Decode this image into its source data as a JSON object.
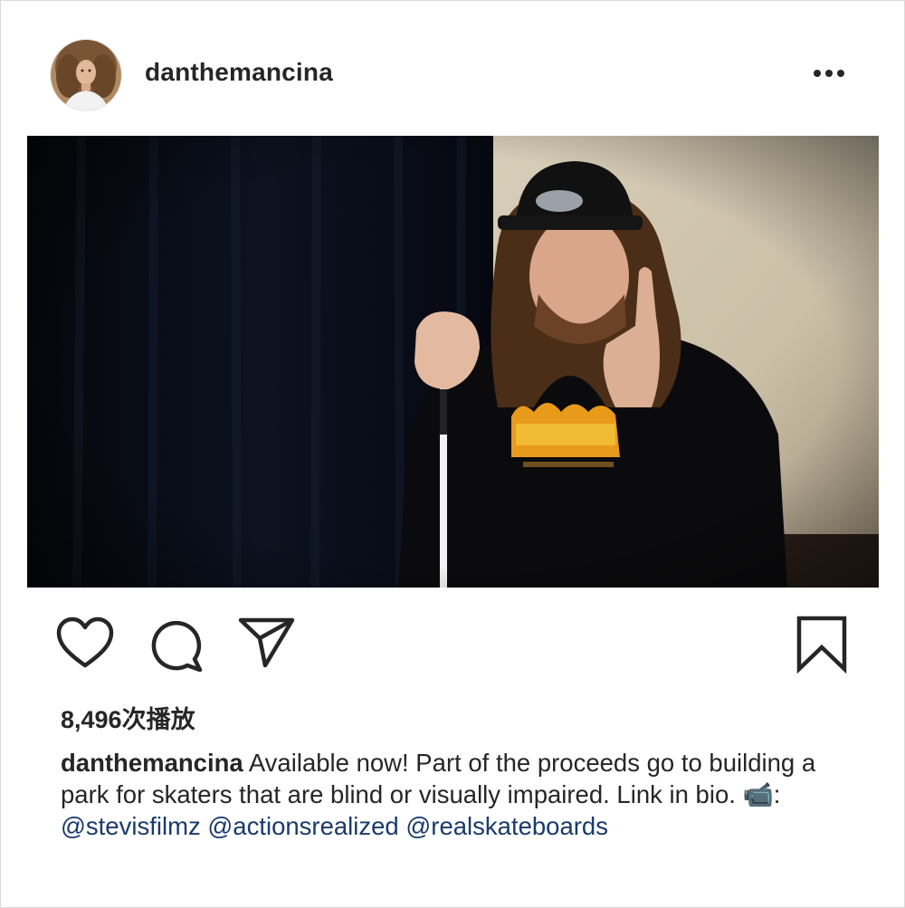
{
  "post": {
    "username": "danthemancina",
    "more_icon": "more-horizontal-icon",
    "media_type": "video"
  },
  "actions": {
    "like_icon": "heart-icon",
    "comment_icon": "comment-bubble-icon",
    "share_icon": "paper-plane-icon",
    "save_icon": "bookmark-icon"
  },
  "stats": {
    "views_text": "8,496次播放"
  },
  "caption": {
    "username": "danthemancina",
    "text_line": " Available now! Part of the proceeds go to building a park for skaters that are blind or visually impaired. Link in bio. ",
    "emoji": "📹",
    "colon": ": ",
    "mentions": [
      "@stevisfilmz",
      "@actionsrealized",
      "@realskateboards"
    ]
  },
  "colors": {
    "text": "#262626",
    "mention": "#1a3a6b",
    "border": "#dbdbdb"
  }
}
